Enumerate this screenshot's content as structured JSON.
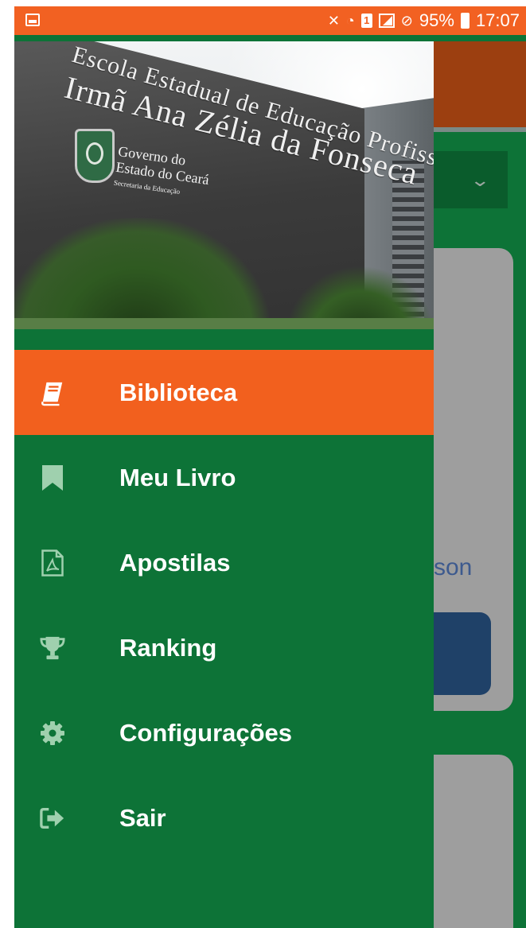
{
  "status_bar": {
    "battery": "95%",
    "time": "17:07",
    "sim_label": "1",
    "icons": [
      "gallery-icon",
      "mute-icon",
      "wifi-icon",
      "sim-icon",
      "signal-icon",
      "dnd-icon",
      "battery-icon"
    ]
  },
  "drawer": {
    "header_sign": {
      "line1": "Escola Estadual de Educação Profissional",
      "line2": "Irmã Ana Zélia da Fonseca",
      "gov_line1": "Governo do",
      "gov_line2": "Estado do Ceará",
      "gov_line3": "Secretaria da Educação"
    },
    "menu": [
      {
        "label": "Biblioteca",
        "icon": "book-icon",
        "active": true
      },
      {
        "label": "Meu Livro",
        "icon": "bookmark-icon",
        "active": false
      },
      {
        "label": "Apostilas",
        "icon": "pdf-file-icon",
        "active": false
      },
      {
        "label": "Ranking",
        "icon": "trophy-icon",
        "active": false
      },
      {
        "label": "Configurações",
        "icon": "gear-icon",
        "active": false
      },
      {
        "label": "Sair",
        "icon": "sign-out-icon",
        "active": false
      }
    ]
  },
  "background_app": {
    "partial_text": "son"
  },
  "colors": {
    "status_bar": "#f26122",
    "drawer_bg": "#0d7337",
    "active_item": "#f2601e",
    "icon_tint": "#9fd0ae",
    "header_bg": "#9c3f10"
  }
}
